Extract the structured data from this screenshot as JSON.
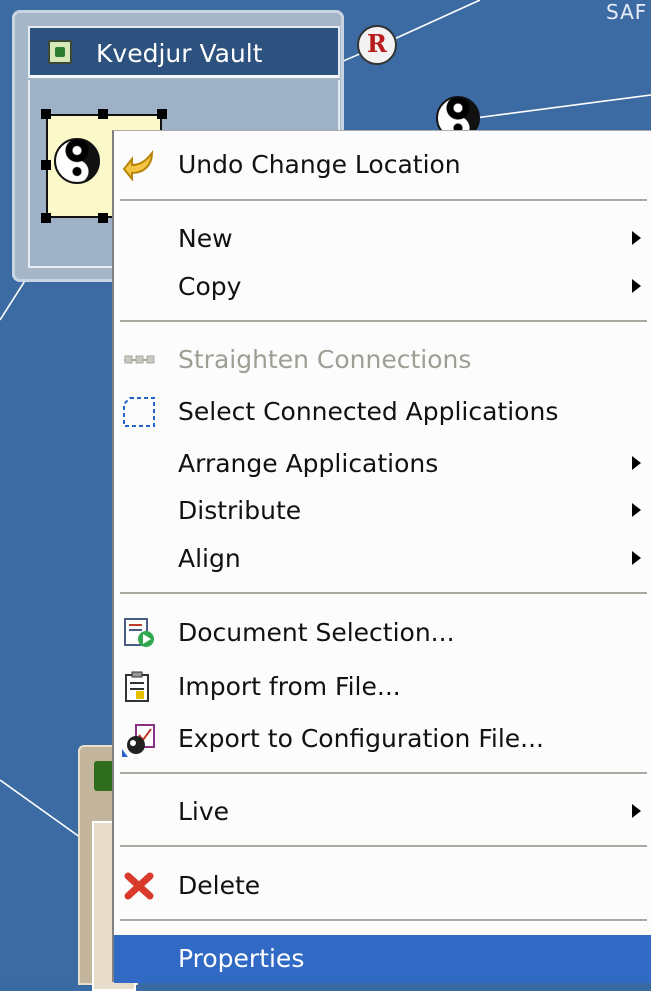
{
  "canvas": {
    "top_label": "SAF",
    "vault_title": "Kvedjur Vault"
  },
  "context_menu": {
    "items": [
      {
        "label": "Undo Change Location",
        "icon": "undo-arrow-icon",
        "submenu": false,
        "disabled": false
      },
      {
        "label": "New",
        "icon": null,
        "submenu": true,
        "disabled": false
      },
      {
        "label": "Copy",
        "icon": null,
        "submenu": true,
        "disabled": false
      },
      {
        "label": "Straighten Connections",
        "icon": "straighten-connections-icon",
        "submenu": false,
        "disabled": true
      },
      {
        "label": "Select Connected Applications",
        "icon": "dashed-selection-icon",
        "submenu": false,
        "disabled": false
      },
      {
        "label": "Arrange Applications",
        "icon": null,
        "submenu": true,
        "disabled": false
      },
      {
        "label": "Distribute",
        "icon": null,
        "submenu": true,
        "disabled": false
      },
      {
        "label": "Align",
        "icon": null,
        "submenu": true,
        "disabled": false
      },
      {
        "label": "Document Selection...",
        "icon": "document-selection-icon",
        "submenu": false,
        "disabled": false
      },
      {
        "label": "Import from File...",
        "icon": "import-file-icon",
        "submenu": false,
        "disabled": false
      },
      {
        "label": "Export to Configuration File...",
        "icon": "export-config-icon",
        "submenu": false,
        "disabled": false
      },
      {
        "label": "Live",
        "icon": null,
        "submenu": true,
        "disabled": false
      },
      {
        "label": "Delete",
        "icon": "delete-x-icon",
        "submenu": false,
        "disabled": false
      },
      {
        "label": "Properties",
        "icon": null,
        "submenu": false,
        "disabled": false,
        "selected": true
      }
    ],
    "colors": {
      "highlight": "#316ac5",
      "disabled_text": "#9e9e95",
      "canvas_background": "#3c6ba4"
    }
  }
}
